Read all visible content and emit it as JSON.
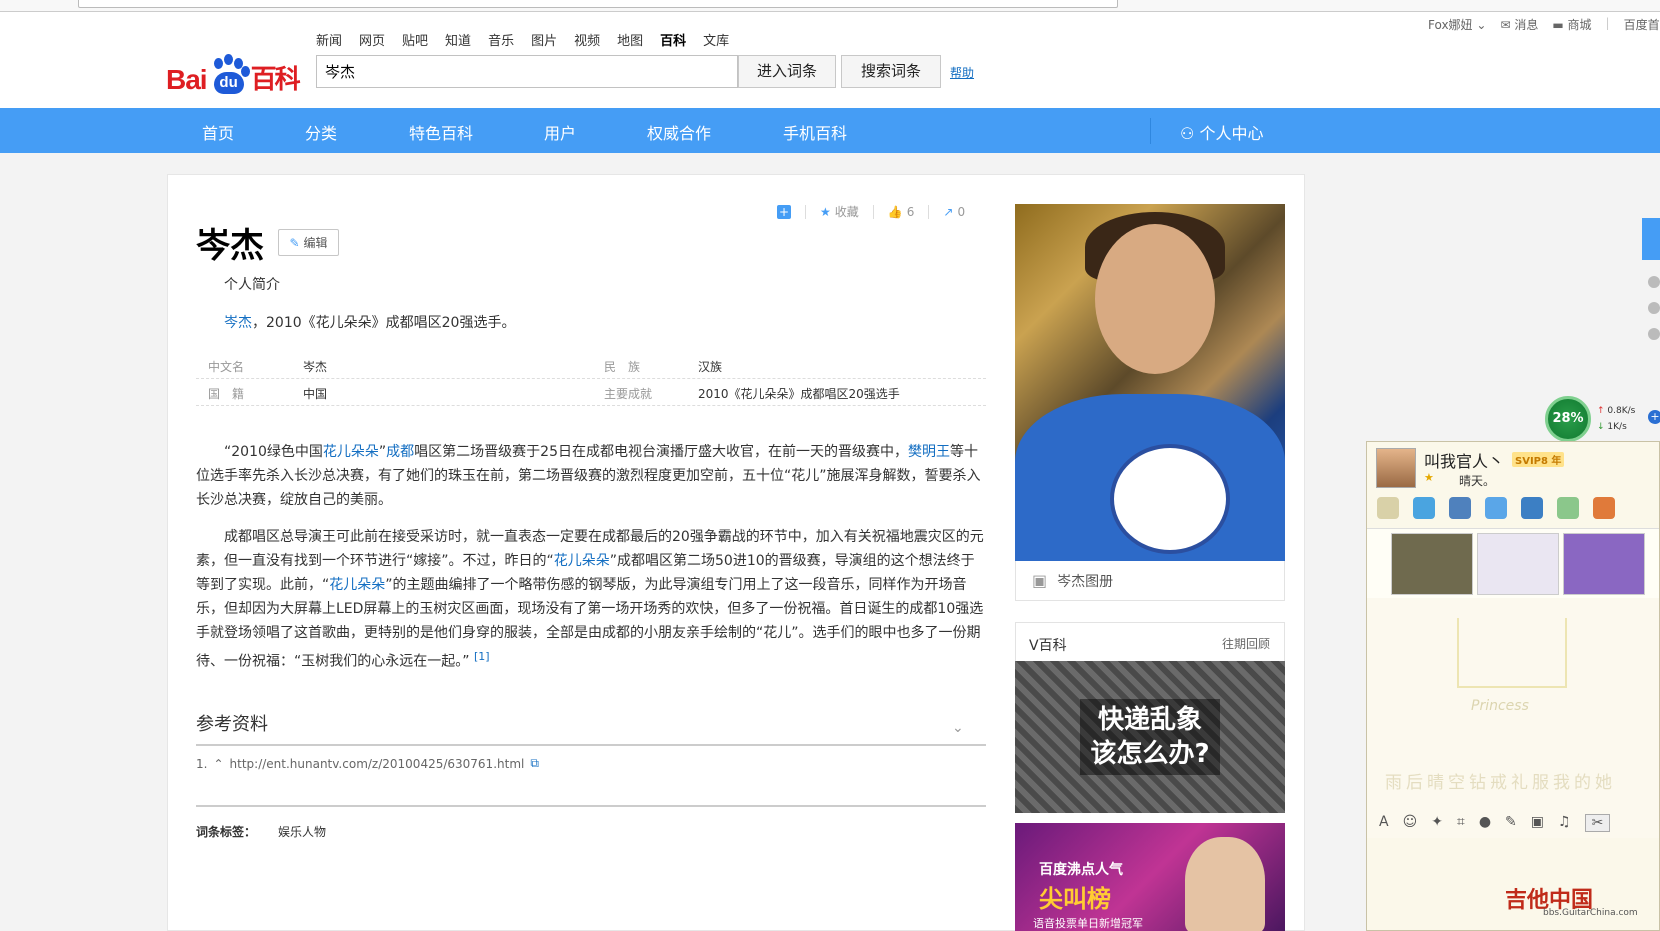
{
  "header": {
    "logo": {
      "text_left": "Bai",
      "text_paw": "du",
      "text_right": "百科"
    },
    "topnav": [
      "新闻",
      "网页",
      "贴吧",
      "知道",
      "音乐",
      "图片",
      "视频",
      "地图",
      "百科",
      "文库"
    ],
    "topnav_active": "百科",
    "search": {
      "value": "岑杰",
      "enter_label": "进入词条",
      "search_label": "搜索词条",
      "help_label": "帮助"
    },
    "userbar": {
      "user": "Fox娜妞",
      "messages": "消息",
      "mall": "商城",
      "baidu": "百度首"
    }
  },
  "mainnav": {
    "items": [
      "首页",
      "分类",
      "特色百科",
      "用户",
      "权威合作",
      "手机百科"
    ],
    "user_center": "个人中心"
  },
  "article": {
    "tools": {
      "fav": "收藏",
      "likes": "6",
      "shares": "0"
    },
    "title": "岑杰",
    "edit_label": "编辑",
    "subtitle": "个人简介",
    "intro_link": "岑杰",
    "intro_rest": "，2010《花儿朵朵》成都唱区20强选手。",
    "info": [
      {
        "k": "中文名",
        "v": "岑杰",
        "k2": "民　族",
        "v2": "汉族"
      },
      {
        "k": "国　籍",
        "v": "中国",
        "k2": "主要成就",
        "v2": "2010《花儿朵朵》成都唱区20强选手"
      }
    ],
    "p1": {
      "a": "“2010绿色中国",
      "link1": "花儿朵朵",
      "b": "”",
      "link2": "成都",
      "c": "唱区第二场晋级赛于25日在成都电视台演播厅盛大收官，在前一天的晋级赛中，",
      "link3": "樊明王",
      "d": "等十位选手率先杀入长沙总决赛，有了她们的珠玉在前，第二场晋级赛的激烈程度更加空前，五十位“花儿”施展浑身解数，誓要杀入长沙总决赛，绽放自己的美丽。"
    },
    "p2": {
      "a": "成都唱区总导演王可此前在接受采访时，就一直表态一定要在成都最后的20强争霸战的环节中，加入有关祝福地震灾区的元素，但一直没有找到一个环节进行“嫁接”。不过，昨日的“",
      "link1": "花儿朵朵",
      "b": "”成都唱区第二场50进10的晋级赛，导演组的这个想法终于等到了实现。此前，“",
      "link2": "花儿朵朵",
      "c": "”的主题曲编排了一个略带伤感的钢琴版，为此导演组专门用上了这一段音乐，同样作为开场音乐，但却因为大屏幕上LED屏幕上的玉树灾区画面，现场没有了第一场开场秀的欢快，但多了一份祝福。首日诞生的成都10强选手就登场领唱了这首歌曲，更特别的是他们身穿的服装，全部是由成都的小朋友亲手绘制的“花儿”。选手们的眼中也多了一份期待、一份祝福：“玉树我们的心永远在一起。”",
      "sup": "[1]"
    },
    "refs_title": "参考资料",
    "ref1": {
      "num": "1.",
      "url": "http://ent.hunantv.com/z/20100425/630761.html"
    },
    "tags_label": "词条标签：",
    "tags": [
      "娱乐人物"
    ]
  },
  "sidebar": {
    "album": "岑杰图册",
    "vbaike": {
      "title": "V百科",
      "more": "往期回顾",
      "caption1": "快递乱象",
      "caption2": "该怎么办?"
    },
    "promo": {
      "line1": "百度沸点人气",
      "line2": "尖叫榜",
      "line3": "语音投票单日新增冠军"
    }
  },
  "overlays": {
    "speed": {
      "pct": "28%",
      "up": "0.8K/s",
      "down": "1K/s"
    },
    "qq": {
      "name": "叫我官人丶",
      "vip": "SVIP8 年",
      "mood": "晴天。",
      "princess": "Princess",
      "ghost": "雨后晴空钻戒礼服我的她"
    },
    "watermark": {
      "main": "吉他中国",
      "sub": "bbs.GuitarChina.com"
    }
  }
}
